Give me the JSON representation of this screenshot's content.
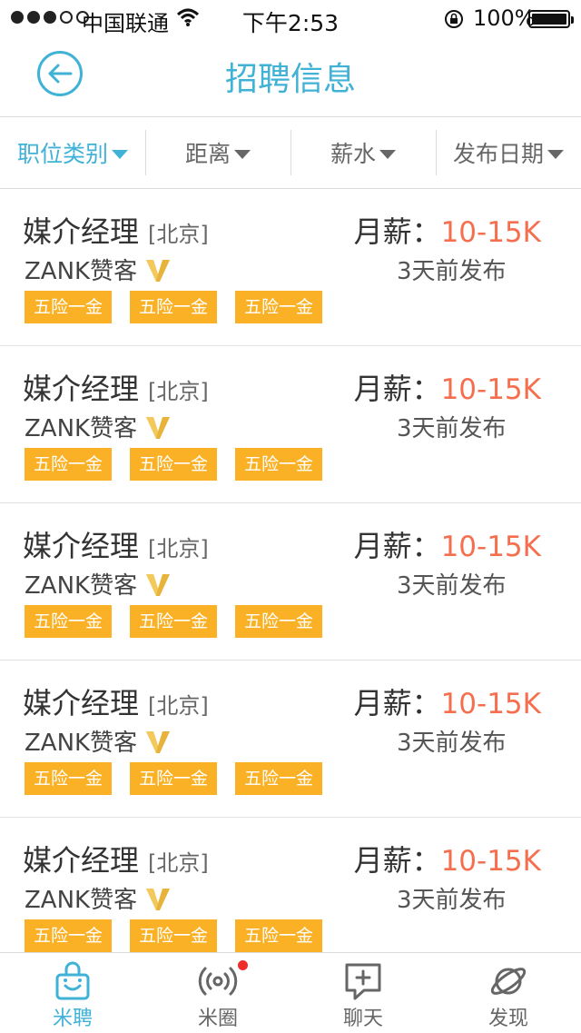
{
  "status_bar": {
    "carrier": "中国联通",
    "time": "下午2:53",
    "battery": "100%"
  },
  "header": {
    "title": "招聘信息"
  },
  "filters": [
    {
      "label": "职位类别",
      "active": true
    },
    {
      "label": "距离",
      "active": false
    },
    {
      "label": "薪水",
      "active": false
    },
    {
      "label": "发布日期",
      "active": false
    }
  ],
  "jobs": [
    {
      "title": "媒介经理",
      "city": "[北京]",
      "company": "ZANK赞客",
      "salary_label": "月薪：",
      "salary": "10-15K",
      "posted": "3天前发布",
      "tags": [
        "五险一金",
        "五险一金",
        "五险一金"
      ]
    },
    {
      "title": "媒介经理",
      "city": "[北京]",
      "company": "ZANK赞客",
      "salary_label": "月薪：",
      "salary": "10-15K",
      "posted": "3天前发布",
      "tags": [
        "五险一金",
        "五险一金",
        "五险一金"
      ]
    },
    {
      "title": "媒介经理",
      "city": "[北京]",
      "company": "ZANK赞客",
      "salary_label": "月薪：",
      "salary": "10-15K",
      "posted": "3天前发布",
      "tags": [
        "五险一金",
        "五险一金",
        "五险一金"
      ]
    },
    {
      "title": "媒介经理",
      "city": "[北京]",
      "company": "ZANK赞客",
      "salary_label": "月薪：",
      "salary": "10-15K",
      "posted": "3天前发布",
      "tags": [
        "五险一金",
        "五险一金",
        "五险一金"
      ]
    },
    {
      "title": "媒介经理",
      "city": "[北京]",
      "company": "ZANK赞客",
      "salary_label": "月薪：",
      "salary": "10-15K",
      "posted": "3天前发布",
      "tags": [
        "五险一金",
        "五险一金",
        "五险一金"
      ]
    }
  ],
  "tabs": [
    {
      "label": "米聘",
      "icon": "bag-icon",
      "active": true
    },
    {
      "label": "米圈",
      "icon": "broadcast-icon",
      "active": false
    },
    {
      "label": "聊天",
      "icon": "chat-plus-icon",
      "active": false
    },
    {
      "label": "发现",
      "icon": "planet-icon",
      "active": false
    }
  ],
  "colors": {
    "accent": "#3fb2d6",
    "salary": "#f56e4e",
    "tag": "#fbb125",
    "vip": "#e8b33a",
    "badge": "#f02d2d"
  }
}
